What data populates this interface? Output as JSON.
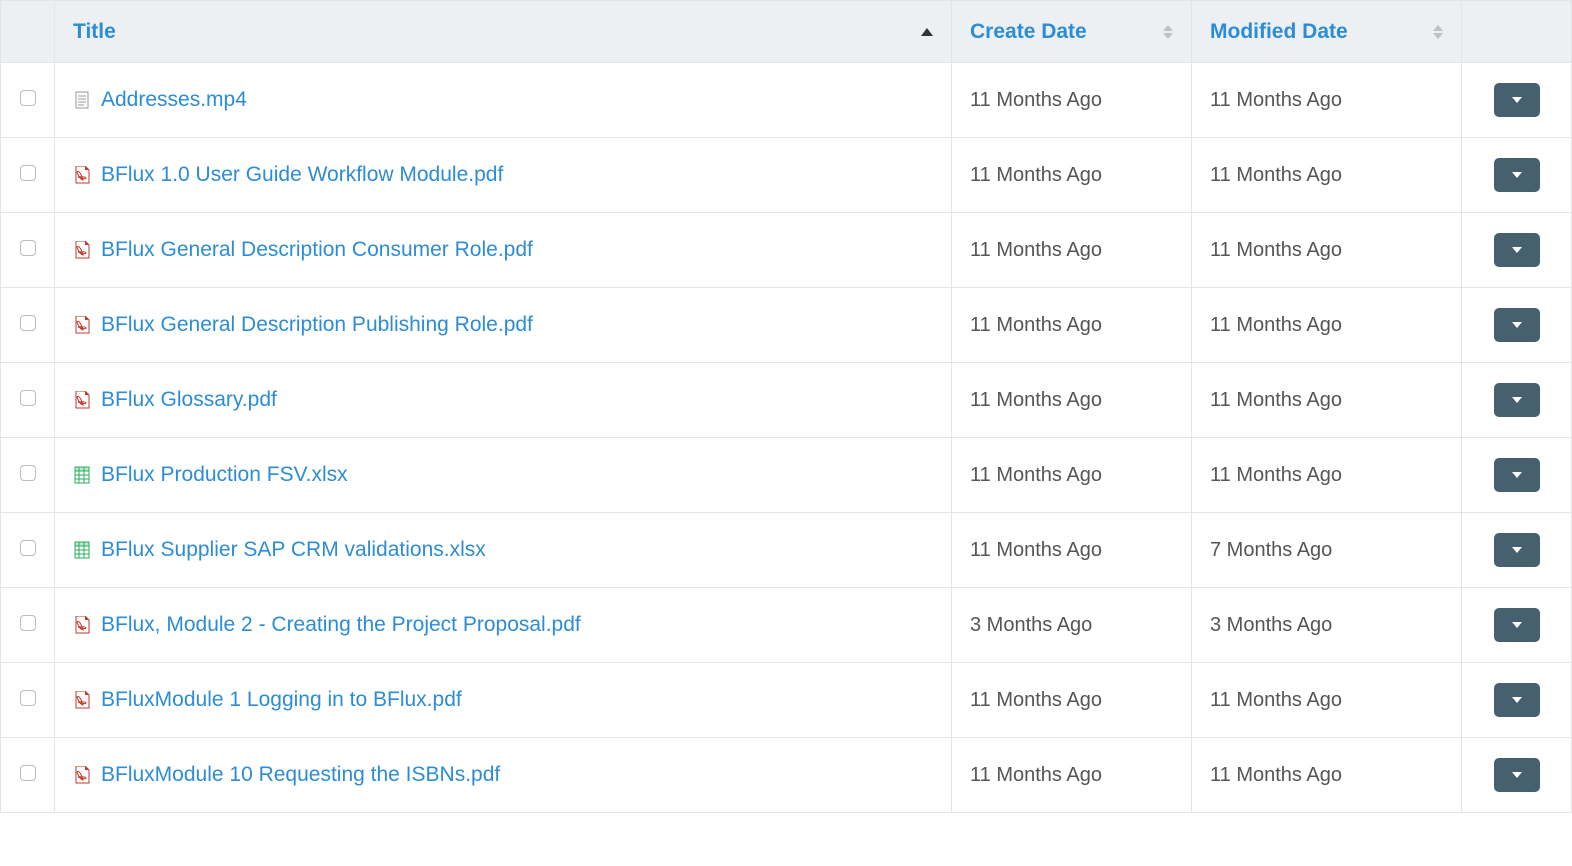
{
  "columns": {
    "title": "Title",
    "create_date": "Create Date",
    "modified_date": "Modified Date"
  },
  "rows": [
    {
      "icon_type": "doc",
      "title": "Addresses.mp4",
      "create_date": "11 Months Ago",
      "modified_date": "11 Months Ago"
    },
    {
      "icon_type": "pdf",
      "title": "BFlux 1.0 User Guide Workflow Module.pdf",
      "create_date": "11 Months Ago",
      "modified_date": "11 Months Ago"
    },
    {
      "icon_type": "pdf",
      "title": "BFlux General Description Consumer Role.pdf",
      "create_date": "11 Months Ago",
      "modified_date": "11 Months Ago"
    },
    {
      "icon_type": "pdf",
      "title": "BFlux General Description Publishing Role.pdf",
      "create_date": "11 Months Ago",
      "modified_date": "11 Months Ago"
    },
    {
      "icon_type": "pdf",
      "title": "BFlux Glossary.pdf",
      "create_date": "11 Months Ago",
      "modified_date": "11 Months Ago"
    },
    {
      "icon_type": "xls",
      "title": "BFlux Production FSV.xlsx",
      "create_date": "11 Months Ago",
      "modified_date": "11 Months Ago"
    },
    {
      "icon_type": "xls",
      "title": "BFlux Supplier SAP CRM validations.xlsx",
      "create_date": "11 Months Ago",
      "modified_date": "7 Months Ago"
    },
    {
      "icon_type": "pdf",
      "title": "BFlux, Module 2 - Creating the Project Proposal.pdf",
      "create_date": "3 Months Ago",
      "modified_date": "3 Months Ago"
    },
    {
      "icon_type": "pdf",
      "title": "BFluxModule 1 Logging in to BFlux.pdf",
      "create_date": "11 Months Ago",
      "modified_date": "11 Months Ago"
    },
    {
      "icon_type": "pdf",
      "title": "BFluxModule 10 Requesting the ISBNs.pdf",
      "create_date": "11 Months Ago",
      "modified_date": "11 Months Ago"
    }
  ]
}
